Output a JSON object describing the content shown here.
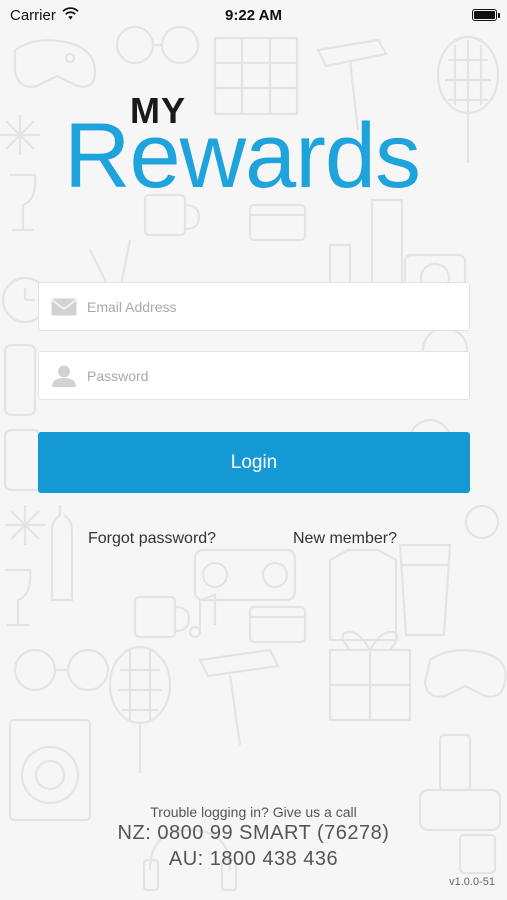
{
  "status_bar": {
    "carrier": "Carrier",
    "time": "9:22 AM"
  },
  "logo": {
    "line1": "MY",
    "line2": "Rewards",
    "accent_color": "#1ea3dc"
  },
  "form": {
    "email_placeholder": "Email Address",
    "password_placeholder": "Password",
    "login_label": "Login",
    "button_color": "#1499d5"
  },
  "links": {
    "forgot_password": "Forgot password?",
    "new_member": "New member?"
  },
  "help": {
    "trouble": "Trouble logging in? Give us a call",
    "nz": "NZ: 0800 99 SMART (76278)",
    "au": "AU: 1800 438 436"
  },
  "version": "v1.0.0-51"
}
